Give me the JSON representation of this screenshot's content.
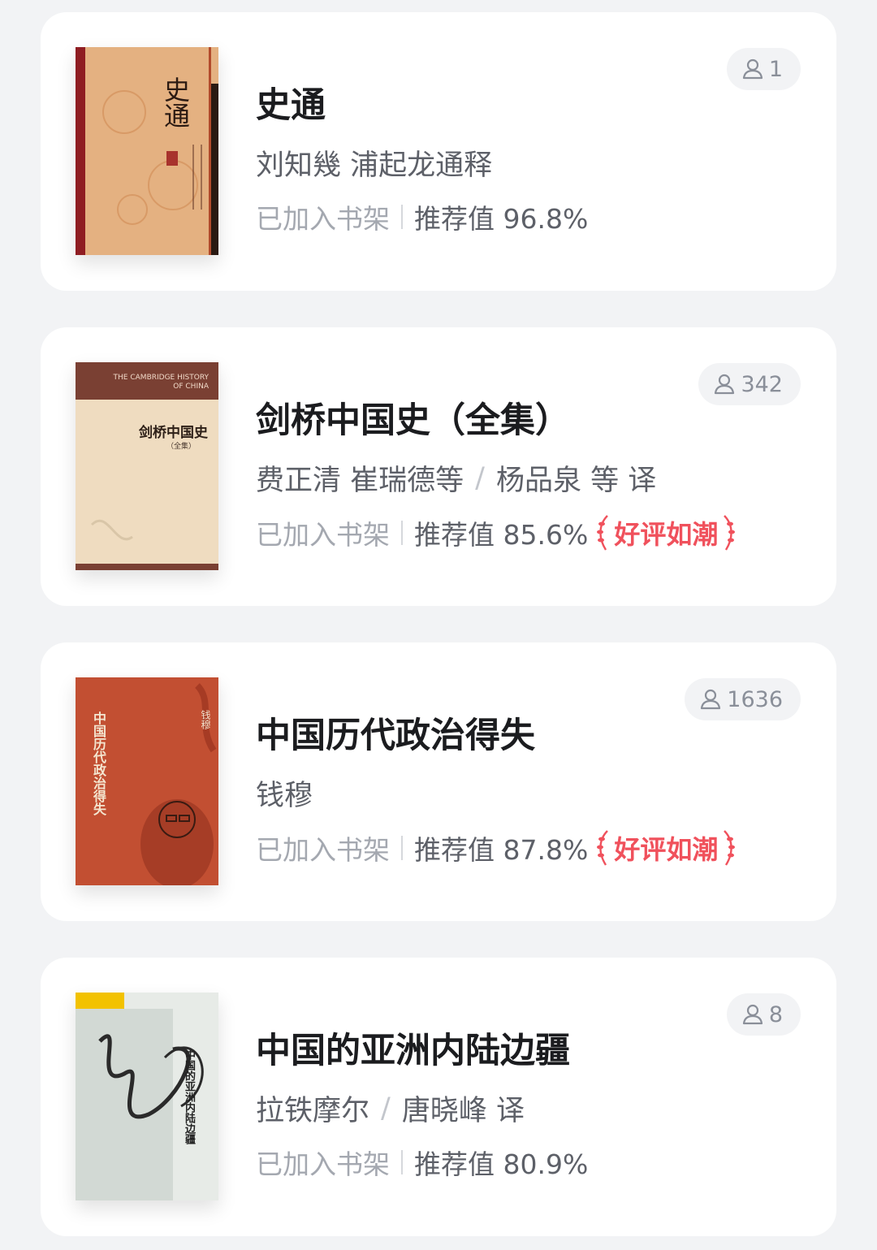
{
  "books": [
    {
      "title": "史通",
      "author": "刘知幾 浦起龙通释",
      "translator": "",
      "shelf_status": "已加入书架",
      "recommend": "推荐值 96.8%",
      "readers": "1",
      "badge": "",
      "cover": {
        "text": "史通",
        "bg": "#e8b583",
        "accent": "#8f1d22"
      }
    },
    {
      "title": "剑桥中国史（全集）",
      "author": "费正清 崔瑞德等",
      "translator": "杨品泉 等 译",
      "shelf_status": "已加入书架",
      "recommend": "推荐值 85.6%",
      "readers": "342",
      "badge": "好评如潮",
      "cover": {
        "text_en": "THE CAMBRIDGE HISTORY OF CHINA",
        "text": "剑桥中国史",
        "sub": "（全集）",
        "bg": "#efdcc0",
        "accent": "#7a4033"
      }
    },
    {
      "title": "中国历代政治得失",
      "author": "钱穆",
      "translator": "",
      "shelf_status": "已加入书架",
      "recommend": "推荐值 87.8%",
      "readers": "1636",
      "badge": "好评如潮",
      "cover": {
        "text": "中国历代政治得失",
        "author": "钱穆",
        "bg": "#c24f32",
        "accent": "#f4e6d0"
      }
    },
    {
      "title": "中国的亚洲内陆边疆",
      "author": "拉铁摩尔",
      "translator": "唐晓峰 译",
      "shelf_status": "已加入书架",
      "recommend": "推荐值 80.9%",
      "readers": "8",
      "badge": "",
      "cover": {
        "text": "中国的亚洲内陆边疆",
        "bg": "#e7ebe7",
        "accent": "#f2c200"
      }
    }
  ],
  "icons": {
    "readers": "person-outline-icon",
    "badge": "laurel-icon"
  },
  "colors": {
    "badge": "#f0515c",
    "background": "#f2f3f5",
    "card": "#ffffff"
  }
}
